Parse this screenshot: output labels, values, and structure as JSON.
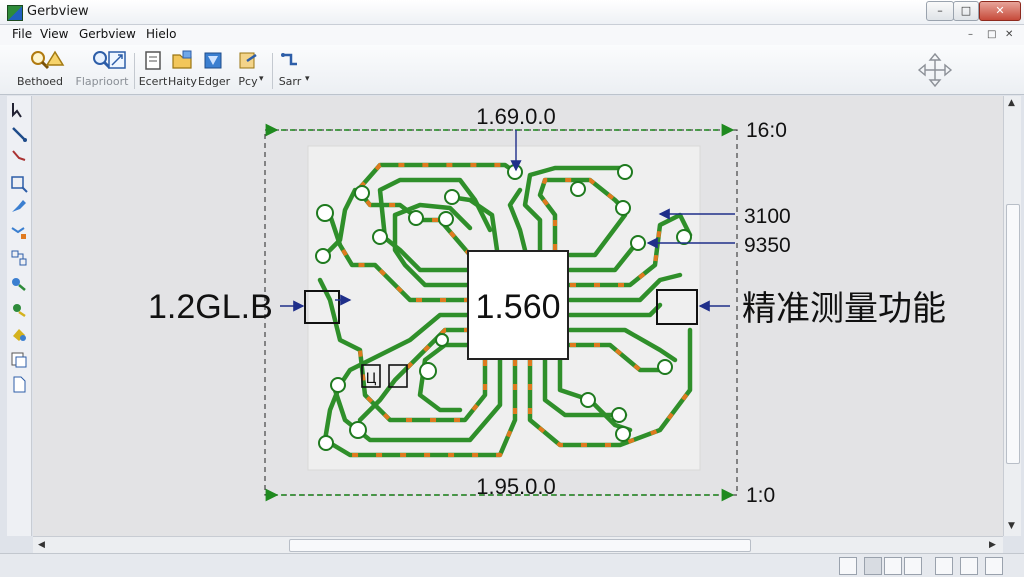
{
  "window": {
    "title": "Gerbview",
    "minimize_label": "–",
    "restore_label": "□",
    "close_label": "✕"
  },
  "menu": {
    "items": [
      "File",
      "View",
      "Gerbview",
      "Hielo"
    ],
    "mdi_controls": [
      "–",
      "□",
      "✕"
    ]
  },
  "toolbar": {
    "buttons": [
      {
        "label": "Bethoed",
        "icon": "magnifier-icon"
      },
      {
        "label": "",
        "icon": "layers-icon"
      },
      {
        "label": "Flaprioort",
        "icon": "zoom-icon"
      },
      {
        "label": "",
        "icon": "zoom-fit-icon"
      },
      {
        "label": "Ecert",
        "icon": "document-icon"
      },
      {
        "label": "Haity",
        "icon": "folder-icon"
      },
      {
        "label": "Edger",
        "icon": "book-icon"
      },
      {
        "label": "Pcy",
        "icon": "export-icon"
      },
      {
        "label": "Sarr",
        "icon": "route-icon"
      }
    ],
    "move_icon": "move-icon"
  },
  "left_tools": [
    "select-arrow-icon",
    "route-icon",
    "wire-icon",
    "rect-select-icon",
    "highlight-icon",
    "measure-icon",
    "grid-icon",
    "net-icon",
    "pad-icon",
    "paint-icon",
    "layer-icon",
    "page-icon"
  ],
  "canvas": {
    "top_dimension": "1.69.0.0",
    "bottom_dimension": "1.95.0.0",
    "right_top_value": "16:0",
    "right_bottom_value": "1:0",
    "right_value_1": "3100",
    "right_value_2": "9350",
    "left_label": "1.2GL.B",
    "chip_label": "1.560",
    "right_label": "精准测量功能",
    "small_box_label": "Ц",
    "trace_color": "#2f8f2a",
    "pad_color": "#e07a1f",
    "dimension_color": "#1f8a1f"
  },
  "scroll": {
    "up": "▲",
    "down": "▼",
    "left": "◀",
    "right": "▶"
  }
}
